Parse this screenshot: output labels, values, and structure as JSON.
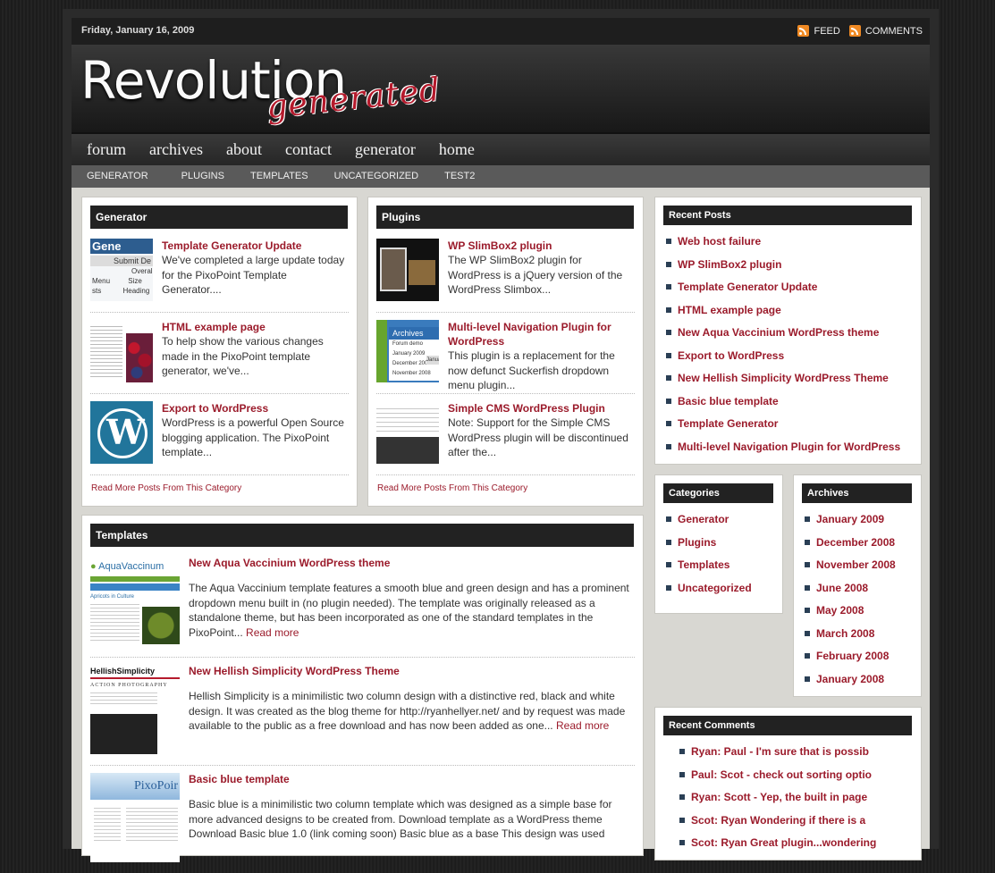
{
  "topbar": {
    "date": "Friday, January 16, 2009",
    "feed_label": "FEED",
    "comments_label": "COMMENTS"
  },
  "logo": {
    "main": "Revolution",
    "sub": "generated"
  },
  "mainnav": [
    "forum",
    "archives",
    "about",
    "contact",
    "generator",
    "home"
  ],
  "subnav": [
    "GENERATOR",
    "PLUGINS",
    "TEMPLATES",
    "UNCATEGORIZED",
    "TEST2"
  ],
  "generator": {
    "heading": "Generator",
    "posts": [
      {
        "title": "Template Generator Update",
        "excerpt": "We've completed a large update today for the PixoPoint Template Generator...."
      },
      {
        "title": "HTML example page",
        "excerpt": "To help show the various changes made in the PixoPoint template generator, we've..."
      },
      {
        "title": "Export to WordPress",
        "excerpt": "WordPress is a powerful Open Source blogging application. The PixoPoint template..."
      }
    ],
    "readmore": "Read More Posts From This Category"
  },
  "plugins": {
    "heading": "Plugins",
    "posts": [
      {
        "title": "WP SlimBox2 plugin",
        "excerpt": "The WP SlimBox2 plugin for WordPress is a jQuery version of the WordPress Slimbox..."
      },
      {
        "title": "Multi-level Navigation Plugin for WordPress",
        "excerpt": "This plugin is a replacement for the now defunct Suckerfish dropdown menu plugin..."
      },
      {
        "title": "Simple CMS WordPress Plugin",
        "excerpt": "Note: Support for the Simple CMS WordPress plugin will be discontinued after the..."
      }
    ],
    "readmore": "Read More Posts From This Category"
  },
  "templates": {
    "heading": "Templates",
    "posts": [
      {
        "title": "New Aqua Vaccinium WordPress theme",
        "excerpt": "The Aqua Vaccinium template features a smooth blue and green design and has a prominent dropdown menu built in (no plugin needed). The template was originally released as a standalone theme, but has been incorporated as one of the standard templates in the PixoPoint...",
        "readmore": "Read more"
      },
      {
        "title": "New Hellish Simplicity WordPress Theme",
        "excerpt": "Hellish Simplicity is a minimilistic two column design with a distinctive red, black and white design. It was created as the blog theme for http://ryanhellyer.net/ and by request was made available to the public as a free download and has now been added as one...",
        "readmore": "Read more"
      },
      {
        "title": "Basic blue template",
        "excerpt": "Basic blue is a minimilistic two column template which was designed as a simple base for more advanced designs to be created from. Download template as a WordPress theme Download Basic blue 1.0 (link coming soon) Basic blue as a base This design was used",
        "readmore": ""
      }
    ],
    "thumb_texts": {
      "aqua_logo": "AquaVaccinum",
      "aqua_sub": "Apricots in Culture",
      "hellish_logo": "HellishSimplicity",
      "hellish_sub": "ACTION PHOTOGRAPHY",
      "basic_logo": "PixoPoir"
    }
  },
  "thumbs": {
    "gen1": [
      "Gene",
      "Submit De",
      "Overall",
      "Menu",
      "Size",
      "sts",
      "Heading"
    ],
    "multi": [
      "Archives",
      "Forum demo",
      "January 2009",
      "December 2008",
      "November 2008",
      "Janua"
    ]
  },
  "recent_posts": {
    "heading": "Recent Posts",
    "items": [
      "Web host failure",
      "WP SlimBox2 plugin",
      "Template Generator Update",
      "HTML example page",
      "New Aqua Vaccinium WordPress theme",
      "Export to WordPress",
      "New Hellish Simplicity WordPress Theme",
      "Basic blue template",
      "Template Generator",
      "Multi-level Navigation Plugin for WordPress"
    ]
  },
  "categories": {
    "heading": "Categories",
    "items": [
      "Generator",
      "Plugins",
      "Templates",
      "Uncategorized"
    ]
  },
  "archives": {
    "heading": "Archives",
    "items": [
      "January 2009",
      "December 2008",
      "November 2008",
      "June 2008",
      "May 2008",
      "March 2008",
      "February 2008",
      "January 2008"
    ]
  },
  "recent_comments": {
    "heading": "Recent Comments",
    "items": [
      "Ryan: Paul - I'm sure that is possib",
      "Paul: Scot - check out sorting optio",
      "Ryan: Scott - Yep, the built in page",
      "Scot: Ryan Wondering if there is a",
      "Scot: Ryan Great plugin...wondering"
    ]
  },
  "colors": {
    "accent": "#9b1b2b",
    "bullet": "#2a3f55",
    "panel_head": "#222222"
  }
}
